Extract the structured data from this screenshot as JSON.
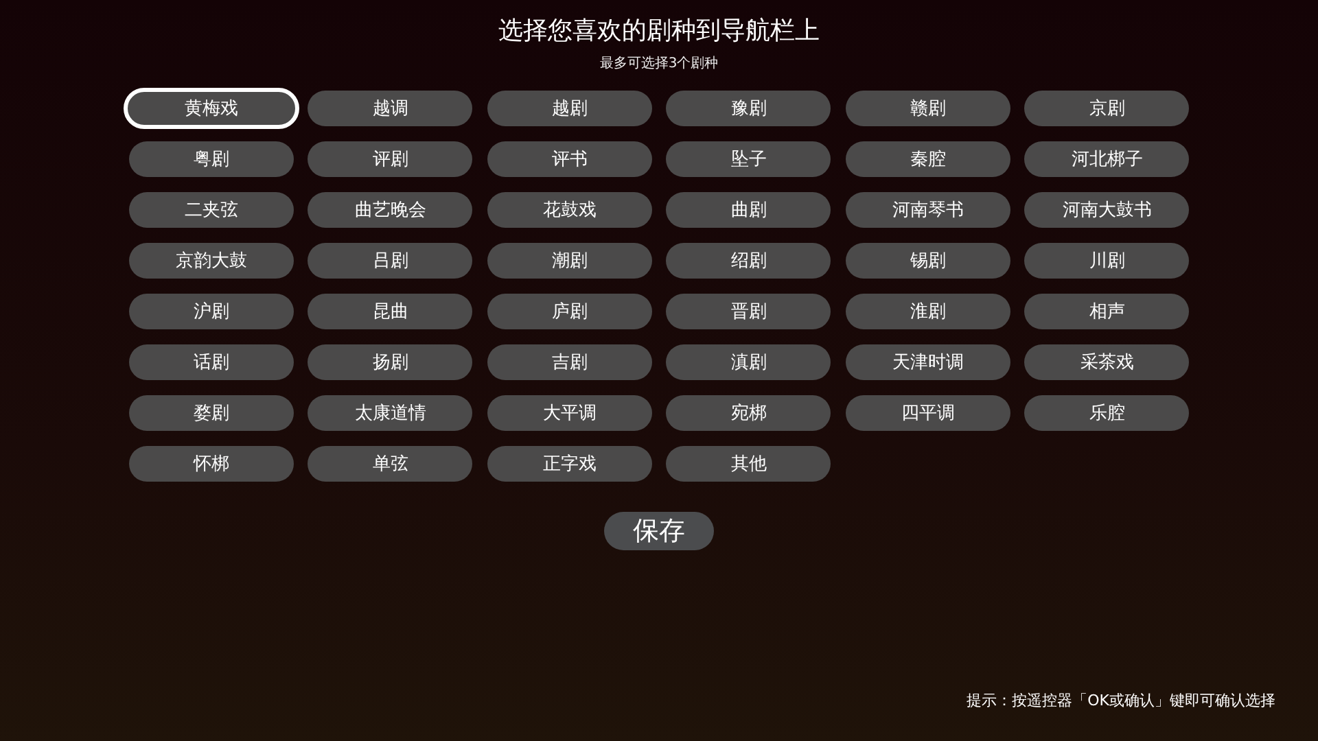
{
  "title": "选择您喜欢的剧种到导航栏上",
  "subtitle": "最多可选择3个剧种",
  "genres": [
    {
      "label": "黄梅戏",
      "focused": true
    },
    {
      "label": "越调",
      "focused": false
    },
    {
      "label": "越剧",
      "focused": false
    },
    {
      "label": "豫剧",
      "focused": false
    },
    {
      "label": "赣剧",
      "focused": false
    },
    {
      "label": "京剧",
      "focused": false
    },
    {
      "label": "粤剧",
      "focused": false
    },
    {
      "label": "评剧",
      "focused": false
    },
    {
      "label": "评书",
      "focused": false
    },
    {
      "label": "坠子",
      "focused": false
    },
    {
      "label": "秦腔",
      "focused": false
    },
    {
      "label": "河北梆子",
      "focused": false
    },
    {
      "label": "二夹弦",
      "focused": false
    },
    {
      "label": "曲艺晚会",
      "focused": false
    },
    {
      "label": "花鼓戏",
      "focused": false
    },
    {
      "label": "曲剧",
      "focused": false
    },
    {
      "label": "河南琴书",
      "focused": false
    },
    {
      "label": "河南大鼓书",
      "focused": false
    },
    {
      "label": "京韵大鼓",
      "focused": false
    },
    {
      "label": "吕剧",
      "focused": false
    },
    {
      "label": "潮剧",
      "focused": false
    },
    {
      "label": "绍剧",
      "focused": false
    },
    {
      "label": "锡剧",
      "focused": false
    },
    {
      "label": "川剧",
      "focused": false
    },
    {
      "label": "沪剧",
      "focused": false
    },
    {
      "label": "昆曲",
      "focused": false
    },
    {
      "label": "庐剧",
      "focused": false
    },
    {
      "label": "晋剧",
      "focused": false
    },
    {
      "label": "淮剧",
      "focused": false
    },
    {
      "label": "相声",
      "focused": false
    },
    {
      "label": "话剧",
      "focused": false
    },
    {
      "label": "扬剧",
      "focused": false
    },
    {
      "label": "吉剧",
      "focused": false
    },
    {
      "label": "滇剧",
      "focused": false
    },
    {
      "label": "天津时调",
      "focused": false
    },
    {
      "label": "采茶戏",
      "focused": false
    },
    {
      "label": "婺剧",
      "focused": false
    },
    {
      "label": "太康道情",
      "focused": false
    },
    {
      "label": "大平调",
      "focused": false
    },
    {
      "label": "宛梆",
      "focused": false
    },
    {
      "label": "四平调",
      "focused": false
    },
    {
      "label": "乐腔",
      "focused": false
    },
    {
      "label": "怀梆",
      "focused": false
    },
    {
      "label": "单弦",
      "focused": false
    },
    {
      "label": "正字戏",
      "focused": false
    },
    {
      "label": "其他",
      "focused": false
    }
  ],
  "save_button": "保存",
  "hint": "提示：按遥控器「OK或确认」键即可确认选择"
}
